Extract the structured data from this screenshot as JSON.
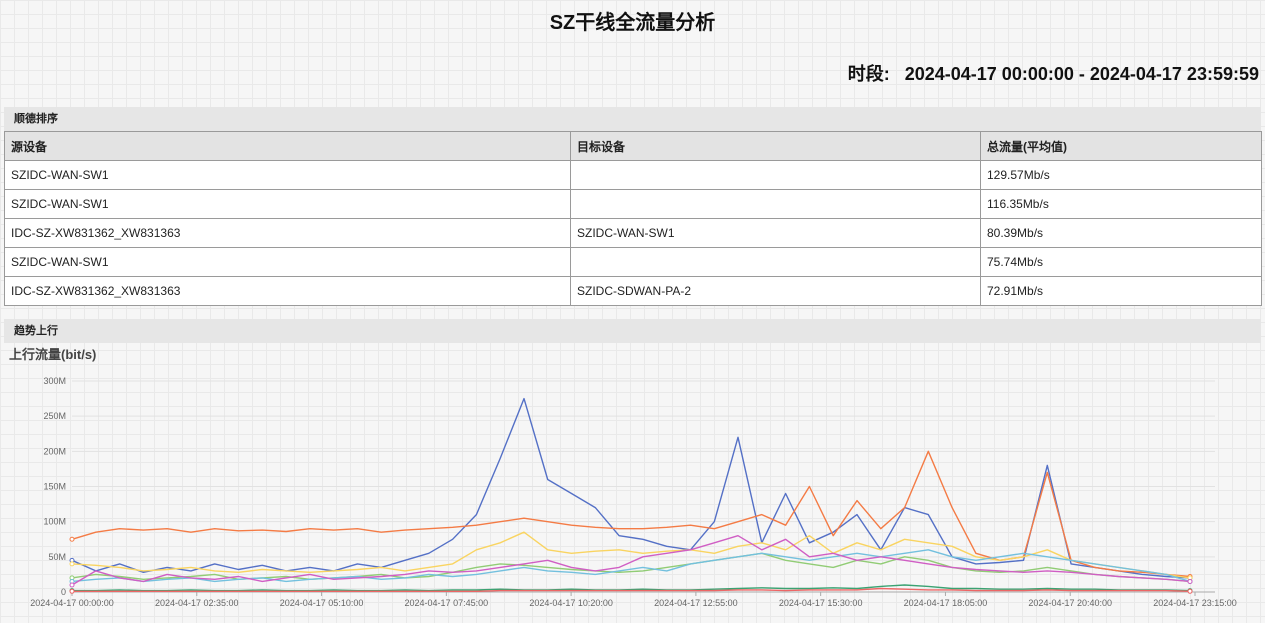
{
  "page": {
    "title": "SZ干线全流量分析",
    "period_label": "时段:",
    "period_value": "2024-04-17 00:00:00 - 2024-04-17 23:59:59"
  },
  "ranking": {
    "section_title": "顺德排序",
    "headers": [
      "源设备",
      "目标设备",
      "总流量(平均值)"
    ],
    "rows": [
      [
        "SZIDC-WAN-SW1",
        "",
        "129.57Mb/s"
      ],
      [
        "SZIDC-WAN-SW1",
        "",
        "116.35Mb/s"
      ],
      [
        "IDC-SZ-XW831362_XW831363",
        "SZIDC-WAN-SW1",
        "80.39Mb/s"
      ],
      [
        "SZIDC-WAN-SW1",
        "",
        "75.74Mb/s"
      ],
      [
        "IDC-SZ-XW831362_XW831363",
        "SZIDC-SDWAN-PA-2",
        "72.91Mb/s"
      ]
    ]
  },
  "trend": {
    "section_title": "趋势上行",
    "chart_title": "上行流量(bit/s)"
  },
  "colors": {
    "blue": "#5470c6",
    "orange": "#f47b45",
    "yellow": "#f9d461",
    "green": "#91cc75",
    "cyan": "#73c0de",
    "magenta": "#d05ec4",
    "darkgreen": "#3ba272",
    "red": "#ee6666"
  },
  "chart_data": {
    "type": "line",
    "title": "上行流量(bit/s)",
    "xlabel": "",
    "ylabel": "",
    "x_ticks": [
      "2024-04-17 00:00:00",
      "2024-04-17 02:35:00",
      "2024-04-17 05:10:00",
      "2024-04-17 07:45:00",
      "2024-04-17 10:20:00",
      "2024-04-17 12:55:00",
      "2024-04-17 15:30:00",
      "2024-04-17 18:05:00",
      "2024-04-17 20:40:00",
      "2024-04-17 23:15:00"
    ],
    "y_ticks": [
      "0",
      "50M",
      "100M",
      "150M",
      "200M",
      "250M",
      "300M"
    ],
    "ylim": [
      0,
      300
    ],
    "y_unit": "M",
    "x": [
      "00:00",
      "00:30",
      "01:00",
      "01:30",
      "02:00",
      "02:30",
      "03:00",
      "03:30",
      "04:00",
      "04:30",
      "05:00",
      "05:30",
      "06:00",
      "06:30",
      "07:00",
      "07:30",
      "08:00",
      "08:30",
      "09:00",
      "09:30",
      "10:00",
      "10:30",
      "11:00",
      "11:30",
      "12:00",
      "12:30",
      "13:00",
      "13:30",
      "14:00",
      "14:30",
      "15:00",
      "15:30",
      "16:00",
      "16:30",
      "17:00",
      "17:30",
      "18:00",
      "18:30",
      "19:00",
      "19:30",
      "20:00",
      "20:30",
      "21:00",
      "21:30",
      "22:00",
      "22:30",
      "23:00",
      "23:30"
    ],
    "grid": true,
    "legend": "none",
    "series": [
      {
        "color": "#5470c6",
        "values": [
          45,
          30,
          40,
          28,
          35,
          30,
          40,
          32,
          38,
          30,
          35,
          30,
          40,
          35,
          45,
          55,
          75,
          110,
          190,
          275,
          160,
          140,
          120,
          80,
          75,
          65,
          60,
          100,
          220,
          70,
          140,
          70,
          85,
          110,
          60,
          120,
          110,
          50,
          40,
          42,
          45,
          180,
          40,
          35,
          30,
          25,
          22,
          20
        ]
      },
      {
        "color": "#f47b45",
        "values": [
          75,
          85,
          90,
          88,
          90,
          85,
          90,
          87,
          88,
          86,
          90,
          88,
          90,
          85,
          88,
          90,
          92,
          95,
          100,
          105,
          100,
          95,
          92,
          90,
          90,
          92,
          95,
          90,
          100,
          110,
          95,
          150,
          80,
          130,
          90,
          120,
          200,
          120,
          55,
          45,
          50,
          170,
          45,
          35,
          30,
          28,
          25,
          22
        ]
      },
      {
        "color": "#f9d461",
        "values": [
          40,
          38,
          35,
          30,
          32,
          35,
          30,
          28,
          32,
          30,
          28,
          30,
          32,
          35,
          30,
          35,
          40,
          60,
          70,
          85,
          60,
          55,
          58,
          60,
          55,
          58,
          60,
          55,
          65,
          70,
          60,
          80,
          55,
          70,
          60,
          75,
          70,
          65,
          50,
          45,
          50,
          60,
          45,
          40,
          35,
          30,
          25,
          20
        ]
      },
      {
        "color": "#91cc75",
        "values": [
          20,
          25,
          22,
          18,
          20,
          22,
          25,
          18,
          20,
          22,
          18,
          20,
          22,
          25,
          20,
          22,
          28,
          35,
          40,
          38,
          35,
          32,
          30,
          28,
          30,
          35,
          40,
          45,
          50,
          55,
          45,
          40,
          35,
          45,
          40,
          50,
          45,
          35,
          30,
          28,
          30,
          35,
          30,
          25,
          22,
          20,
          18,
          15
        ]
      },
      {
        "color": "#73c0de",
        "values": [
          15,
          18,
          20,
          15,
          18,
          20,
          15,
          18,
          20,
          15,
          18,
          20,
          22,
          18,
          20,
          25,
          22,
          25,
          30,
          35,
          30,
          28,
          25,
          30,
          35,
          30,
          40,
          45,
          50,
          55,
          50,
          45,
          50,
          55,
          50,
          55,
          60,
          50,
          45,
          50,
          55,
          50,
          45,
          40,
          35,
          30,
          25,
          15
        ]
      },
      {
        "color": "#d05ec4",
        "values": [
          10,
          30,
          20,
          15,
          25,
          20,
          18,
          22,
          15,
          20,
          25,
          18,
          20,
          22,
          25,
          30,
          28,
          30,
          35,
          40,
          45,
          35,
          30,
          35,
          50,
          55,
          60,
          70,
          80,
          60,
          75,
          50,
          55,
          45,
          50,
          45,
          40,
          35,
          32,
          30,
          28,
          30,
          28,
          25,
          22,
          20,
          18,
          15
        ]
      },
      {
        "color": "#3ba272",
        "values": [
          2,
          2,
          3,
          2,
          2,
          3,
          2,
          2,
          3,
          2,
          2,
          3,
          2,
          2,
          3,
          2,
          3,
          3,
          4,
          3,
          3,
          4,
          3,
          3,
          4,
          3,
          3,
          4,
          5,
          6,
          5,
          5,
          6,
          5,
          8,
          10,
          8,
          5,
          5,
          4,
          4,
          5,
          4,
          4,
          3,
          3,
          3,
          2
        ]
      },
      {
        "color": "#ee6666",
        "values": [
          1,
          1,
          1,
          1,
          1,
          1,
          1,
          1,
          1,
          1,
          1,
          1,
          1,
          1,
          1,
          1,
          1,
          1,
          2,
          2,
          2,
          2,
          2,
          2,
          2,
          2,
          2,
          2,
          3,
          3,
          2,
          3,
          3,
          3,
          5,
          4,
          3,
          3,
          2,
          2,
          2,
          3,
          2,
          2,
          2,
          2,
          2,
          1
        ]
      }
    ]
  }
}
